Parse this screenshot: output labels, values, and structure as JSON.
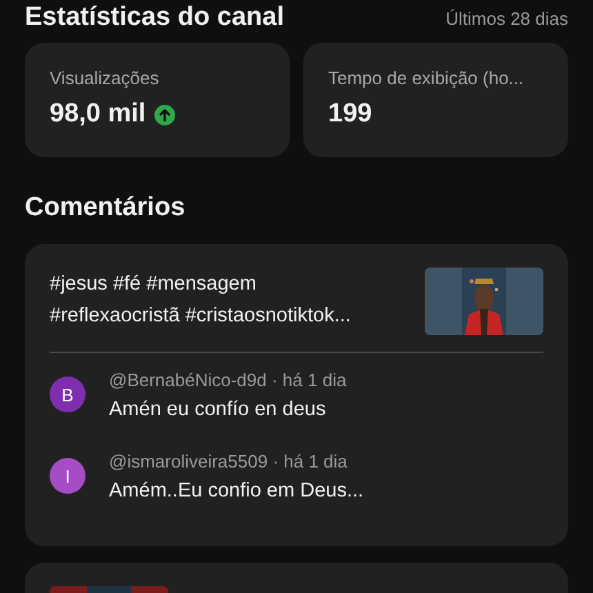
{
  "stats": {
    "title": "Estatísticas do canal",
    "period": "Últimos 28 dias",
    "cards": [
      {
        "label": "Visualizações",
        "value": "98,0 mil",
        "rising": true
      },
      {
        "label": "Tempo de exibição (ho...",
        "value": "199"
      }
    ]
  },
  "comments_section": {
    "title": "Comentários",
    "videos": [
      {
        "caption_lines": [
          "#jesus #fé #mensagem",
          "#reflexaocristã #cristaosnotiktok..."
        ],
        "thumbnail": {
          "kind": "picture"
        },
        "comments": [
          {
            "initial": "B",
            "color": "#7e2fb0",
            "meta": "@BernabéNico-d9d · há 1 dia",
            "text": "Amén eu confío en deus"
          },
          {
            "initial": "I",
            "color": "#a64cc4",
            "meta": "@ismaroliveira5509 · há 1 dia",
            "text": "Amém..Eu confio em Deus..."
          }
        ]
      },
      {
        "thumbnail": {
          "kind": "picture"
        }
      }
    ]
  }
}
